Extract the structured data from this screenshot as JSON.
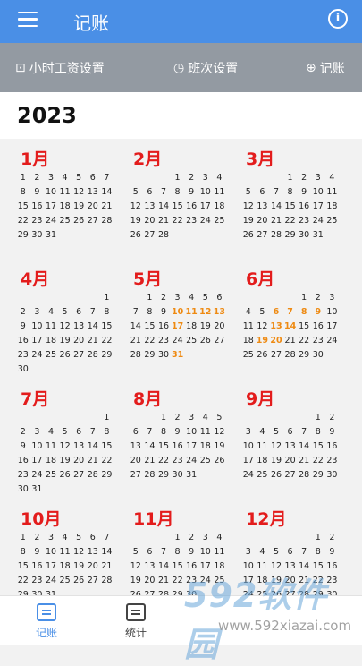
{
  "appbar": {
    "title": "记账",
    "info_glyph": "i",
    "accent": "#4a8fe6"
  },
  "toolbar": {
    "hourly_wage_label": "小时工资设置",
    "shift_label": "班次设置",
    "record_label": "记账"
  },
  "year": "2023",
  "months": [
    {
      "name": "1月",
      "offset": 0,
      "days": 31,
      "highlight": []
    },
    {
      "name": "2月",
      "offset": 3,
      "days": 28,
      "highlight": []
    },
    {
      "name": "3月",
      "offset": 3,
      "days": 31,
      "highlight": []
    },
    {
      "name": "4月",
      "offset": 6,
      "days": 30,
      "highlight": []
    },
    {
      "name": "5月",
      "offset": 1,
      "days": 31,
      "highlight": [
        10,
        11,
        12,
        13,
        17,
        31
      ]
    },
    {
      "name": "6月",
      "offset": 4,
      "days": 30,
      "highlight": [
        6,
        7,
        8,
        9,
        13,
        14,
        19,
        20
      ]
    },
    {
      "name": "7月",
      "offset": 6,
      "days": 31,
      "highlight": []
    },
    {
      "name": "8月",
      "offset": 2,
      "days": 31,
      "highlight": []
    },
    {
      "name": "9月",
      "offset": 5,
      "days": 30,
      "highlight": []
    },
    {
      "name": "10月",
      "offset": 0,
      "days": 31,
      "highlight": []
    },
    {
      "name": "11月",
      "offset": 3,
      "days": 30,
      "highlight": []
    },
    {
      "name": "12月",
      "offset": 5,
      "days": 31,
      "highlight": []
    }
  ],
  "tabs": {
    "record": "记账",
    "stats": "统计"
  },
  "watermark": {
    "brand": "592软件园",
    "url": "www.592xiazai.com"
  },
  "colors": {
    "month_title": "#e31c1c",
    "highlight_day": "#ee8a12"
  }
}
